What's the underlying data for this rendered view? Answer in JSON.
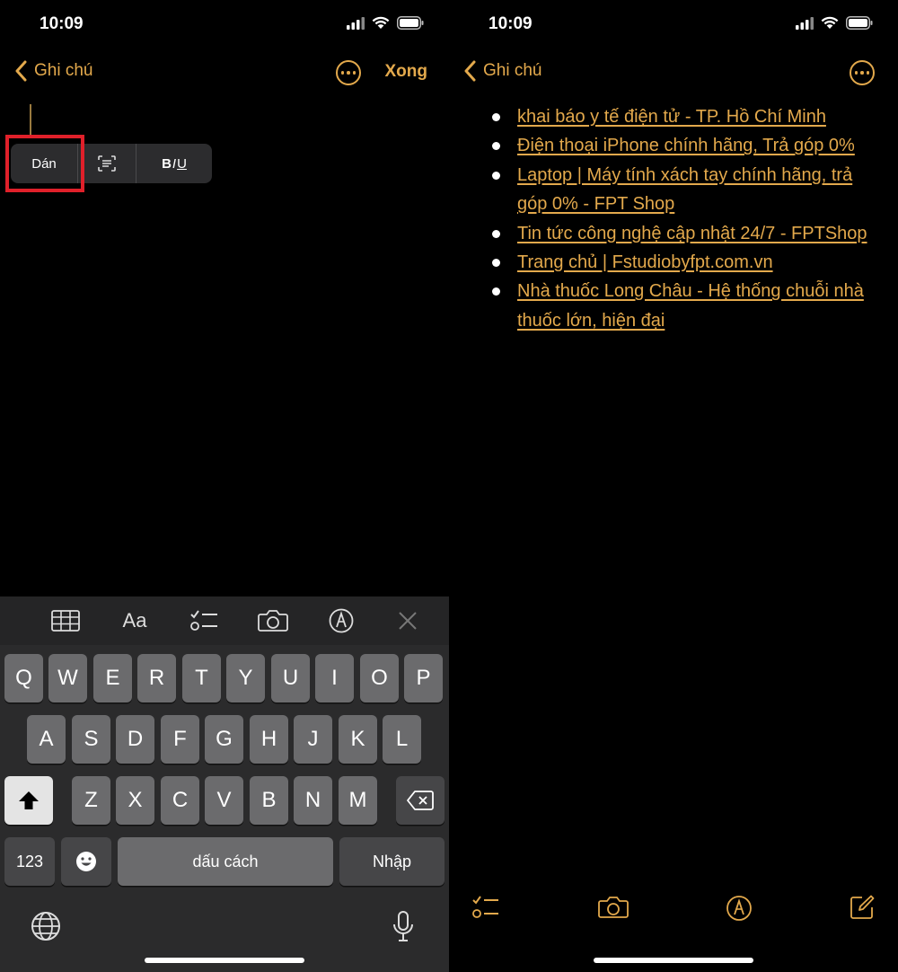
{
  "left": {
    "status": {
      "time": "10:09"
    },
    "nav": {
      "back_label": "Ghi chú",
      "done_label": "Xong"
    },
    "popup": {
      "paste_label": "Dán",
      "format_bold": "B",
      "format_italic": "I",
      "format_underline": "U"
    },
    "keyboard": {
      "row1": [
        "Q",
        "W",
        "E",
        "R",
        "T",
        "Y",
        "U",
        "I",
        "O",
        "P"
      ],
      "row2": [
        "A",
        "S",
        "D",
        "F",
        "G",
        "H",
        "J",
        "K",
        "L"
      ],
      "row3": [
        "Z",
        "X",
        "C",
        "V",
        "B",
        "N",
        "M"
      ],
      "numbers_label": "123",
      "space_label": "dấu cách",
      "return_label": "Nhập",
      "toolbar_text_label": "Aa"
    }
  },
  "right": {
    "status": {
      "time": "10:09"
    },
    "nav": {
      "back_label": "Ghi chú"
    },
    "note_items": [
      "khai báo y tế điện tử - TP. Hồ Chí Minh",
      "Điện thoại iPhone chính hãng, Trả góp 0%",
      "Laptop | Máy tính xách tay chính hãng, trả góp 0% - FPT Shop",
      "Tin tức công nghệ cập nhật 24/7 - FPTShop",
      "Trang chủ | Fstudiobyfpt.com.vn",
      "Nhà thuốc Long Châu - Hệ thống chuỗi nhà thuốc lớn, hiện đại"
    ]
  },
  "colors": {
    "accent": "#e3a94c",
    "highlight": "#e0202a",
    "key": "#6b6b6d",
    "keyboard_bg": "#2b2b2c"
  }
}
